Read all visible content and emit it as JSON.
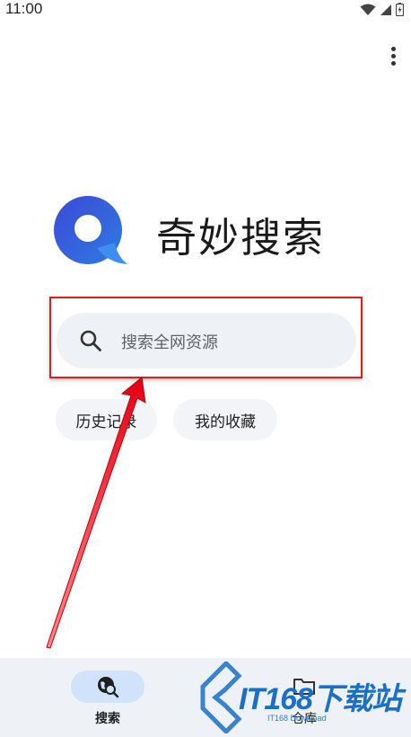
{
  "status_bar": {
    "time": "11:00"
  },
  "app": {
    "title": "奇妙搜索"
  },
  "search": {
    "placeholder": "搜索全网资源"
  },
  "chips": {
    "history": "历史记录",
    "favorites": "我的收藏"
  },
  "bottom_nav": {
    "items": [
      {
        "label": "搜索",
        "icon": "globe-search-icon",
        "active": true
      },
      {
        "label": "仓库",
        "icon": "folder-icon",
        "active": false
      }
    ]
  },
  "watermark": {
    "brand": "IT168下载站",
    "sub": "IT168 Download"
  },
  "colors": {
    "accent": "#3a6fd8",
    "annotation_red": "#e31b1b",
    "nav_active_bg": "#cfe4fb"
  }
}
